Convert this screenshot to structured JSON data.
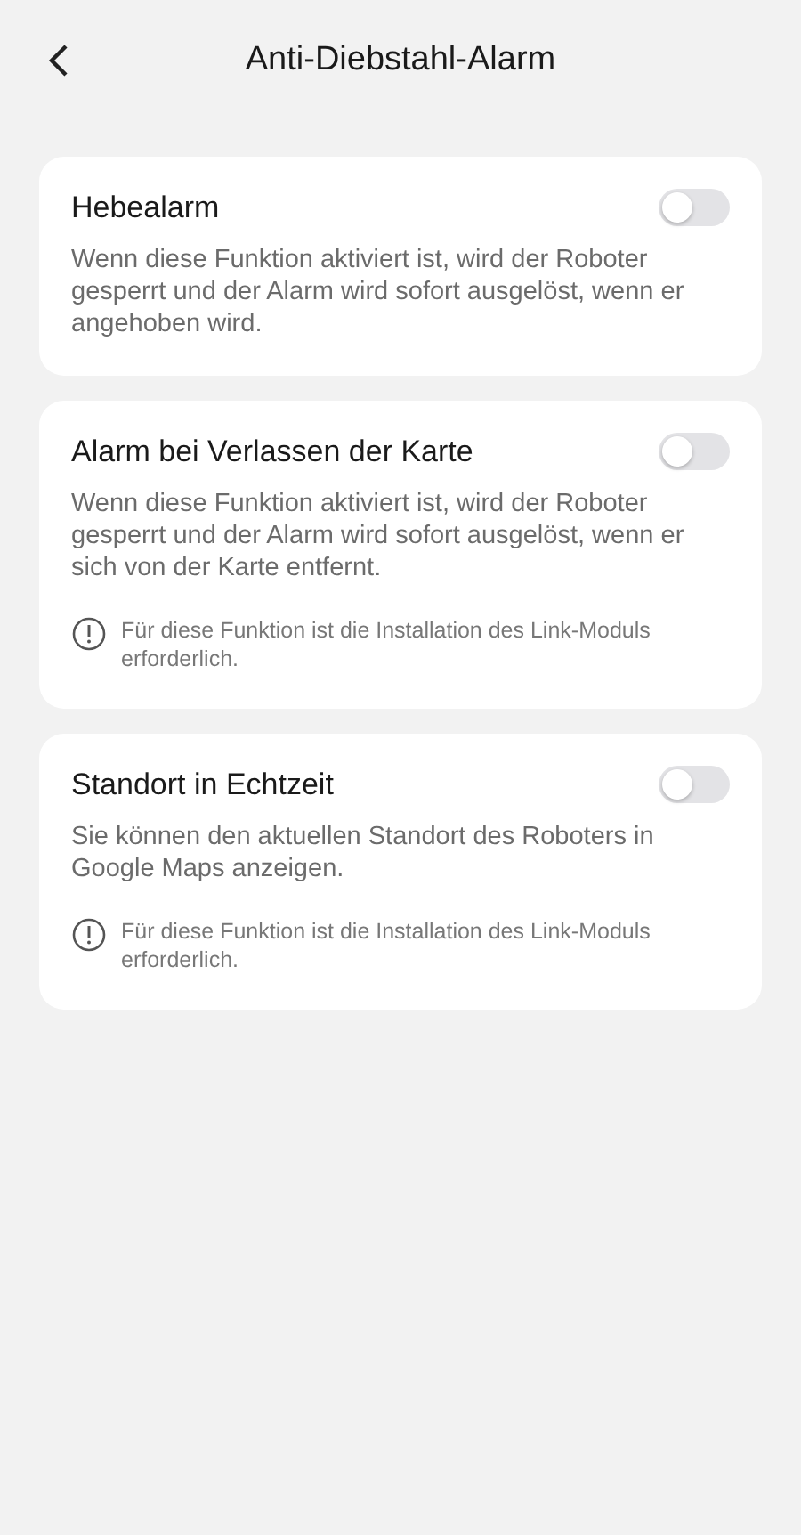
{
  "header": {
    "title": "Anti-Diebstahl-Alarm"
  },
  "settings": [
    {
      "title": "Hebealarm",
      "on": false,
      "description": "Wenn diese Funktion aktiviert ist, wird der Roboter gesperrt und der Alarm wird sofort ausgelöst, wenn er angehoben wird."
    },
    {
      "title": "Alarm bei Verlassen der Karte",
      "on": false,
      "description": "Wenn diese Funktion aktiviert ist, wird der Roboter gesperrt und der Alarm wird sofort ausgelöst, wenn er sich von der Karte entfernt.",
      "note": "Für diese Funktion ist die Installation des Link-Moduls erforderlich."
    },
    {
      "title": "Standort in Echtzeit",
      "on": false,
      "description": "Sie können den aktuellen Standort des Roboters in Google Maps anzeigen.",
      "note": "Für diese Funktion ist die Installation des Link-Moduls erforderlich."
    }
  ]
}
